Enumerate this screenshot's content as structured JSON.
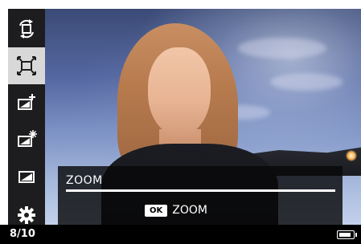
{
  "sidebar": {
    "items": [
      {
        "name": "rotate",
        "icon": "rotate-icon",
        "active": false
      },
      {
        "name": "crop-zoom",
        "icon": "crop-expand-icon",
        "active": true
      },
      {
        "name": "brightness-plus",
        "icon": "image-plus-icon",
        "active": false
      },
      {
        "name": "sparkle",
        "icon": "image-sparkle-icon",
        "active": false
      },
      {
        "name": "image",
        "icon": "image-icon",
        "active": false
      },
      {
        "name": "settings",
        "icon": "gear-icon",
        "active": false
      }
    ]
  },
  "zoom": {
    "title": "ZOOM",
    "ok_key": "OK",
    "ok_label": "ZOOM",
    "level": 1.0
  },
  "status": {
    "counter": "8/10",
    "battery_level": 1.0
  },
  "colors": {
    "sidebar_bg": "#1d1d1f",
    "active_bg": "#d8d8d8",
    "panel_bg": "rgba(8,8,10,0.82)"
  }
}
